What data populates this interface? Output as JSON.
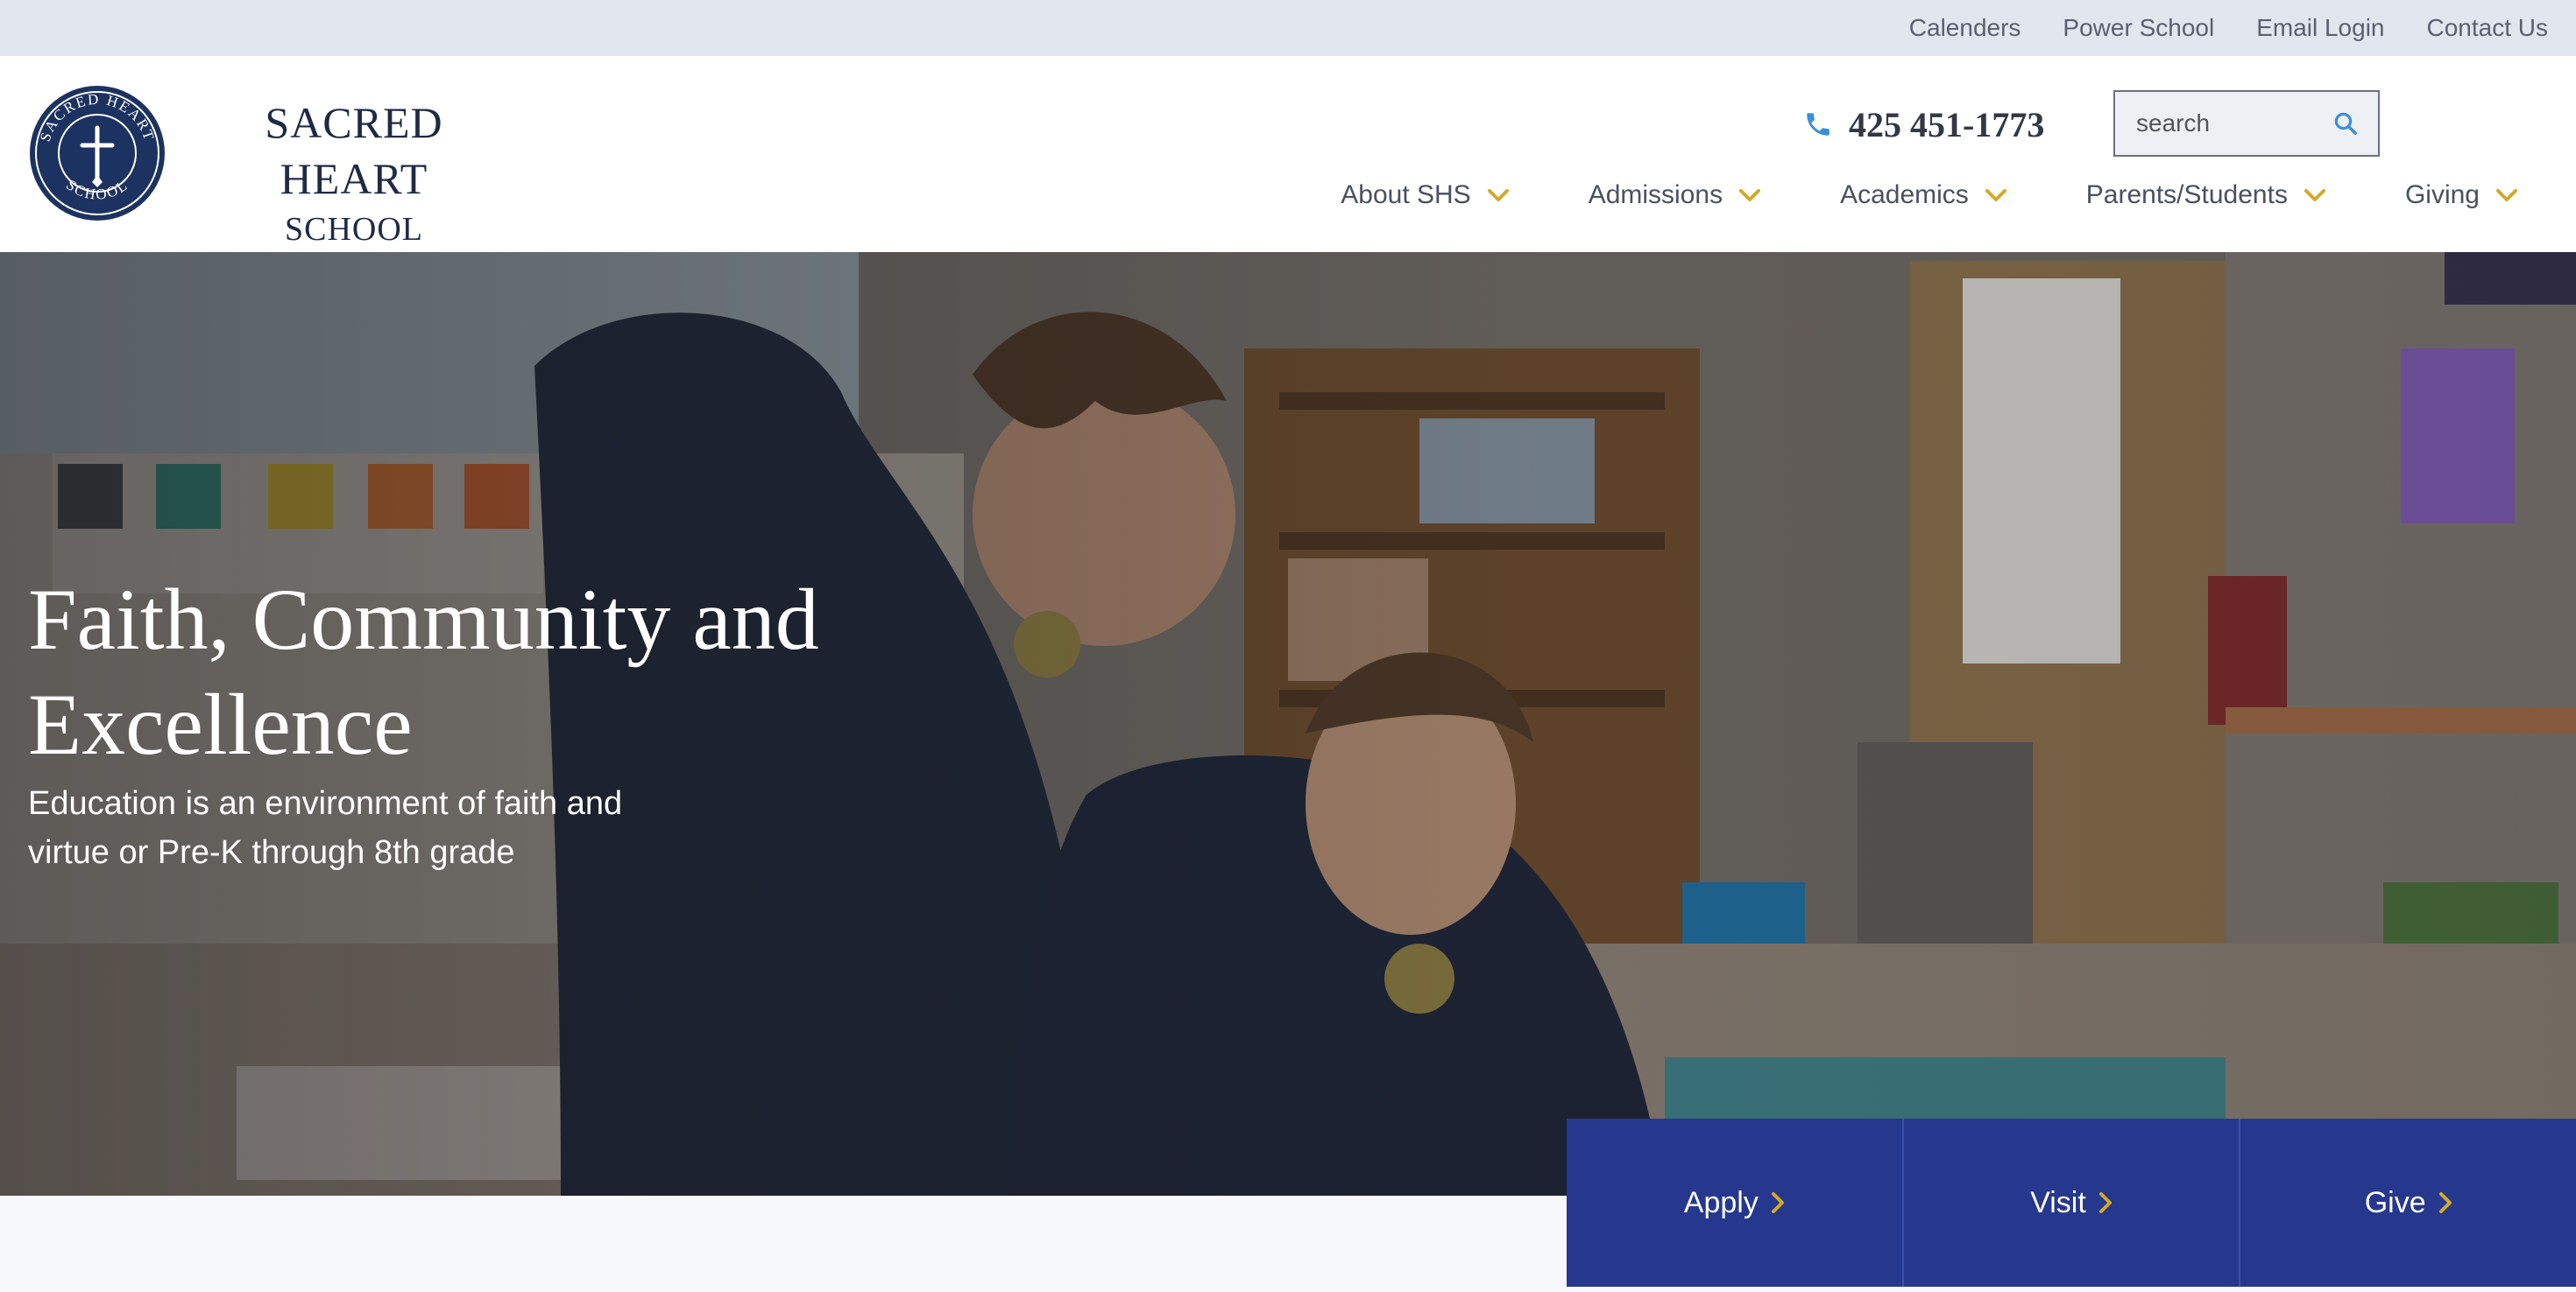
{
  "topbar": {
    "links": [
      "Calenders",
      "Power School",
      "Email Login",
      "Contact Us"
    ]
  },
  "brand": {
    "name_line1": "SACRED HEART",
    "name_line2": "SCHOOL",
    "seal_text": "SACRED HEART SCHOOL"
  },
  "contact": {
    "phone": "425 451-1773",
    "icon": "phone-icon"
  },
  "search": {
    "placeholder": "search",
    "icon": "search-icon"
  },
  "nav": {
    "items": [
      {
        "label": "About SHS"
      },
      {
        "label": "Admissions"
      },
      {
        "label": "Academics"
      },
      {
        "label": "Parents/Students"
      },
      {
        "label": "Giving"
      }
    ]
  },
  "hero": {
    "title": "Faith, Community and Excellence",
    "subtitle": "Education is an environment of faith and virtue or Pre-K through 8th grade"
  },
  "cta": {
    "buttons": [
      "Apply",
      "Visit",
      "Give"
    ]
  },
  "colors": {
    "brand_navy": "#1c3260",
    "accent_gold": "#d4a82a",
    "cta_blue": "#25388e",
    "topbar_bg": "#e2e6ef",
    "search_icon_blue": "#3a8fd8"
  }
}
